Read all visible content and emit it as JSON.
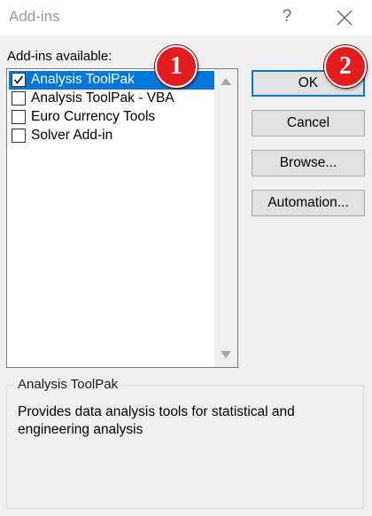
{
  "window": {
    "title": "Add-ins",
    "help_glyph": "?"
  },
  "list": {
    "label": "Add-ins available:",
    "items": [
      {
        "label": "Analysis ToolPak",
        "checked": true,
        "selected": true
      },
      {
        "label": "Analysis ToolPak - VBA",
        "checked": false,
        "selected": false
      },
      {
        "label": "Euro Currency Tools",
        "checked": false,
        "selected": false
      },
      {
        "label": "Solver Add-in",
        "checked": false,
        "selected": false
      }
    ]
  },
  "buttons": {
    "ok": "OK",
    "cancel": "Cancel",
    "browse": "Browse...",
    "automation": "Automation..."
  },
  "badges": {
    "one": "1",
    "two": "2"
  },
  "description": {
    "group_title": "Analysis ToolPak",
    "text": "Provides data analysis tools for statistical and engineering analysis"
  },
  "colors": {
    "selection": "#0078d7",
    "badge": "#e11d1d",
    "background": "#f0f0f0"
  }
}
